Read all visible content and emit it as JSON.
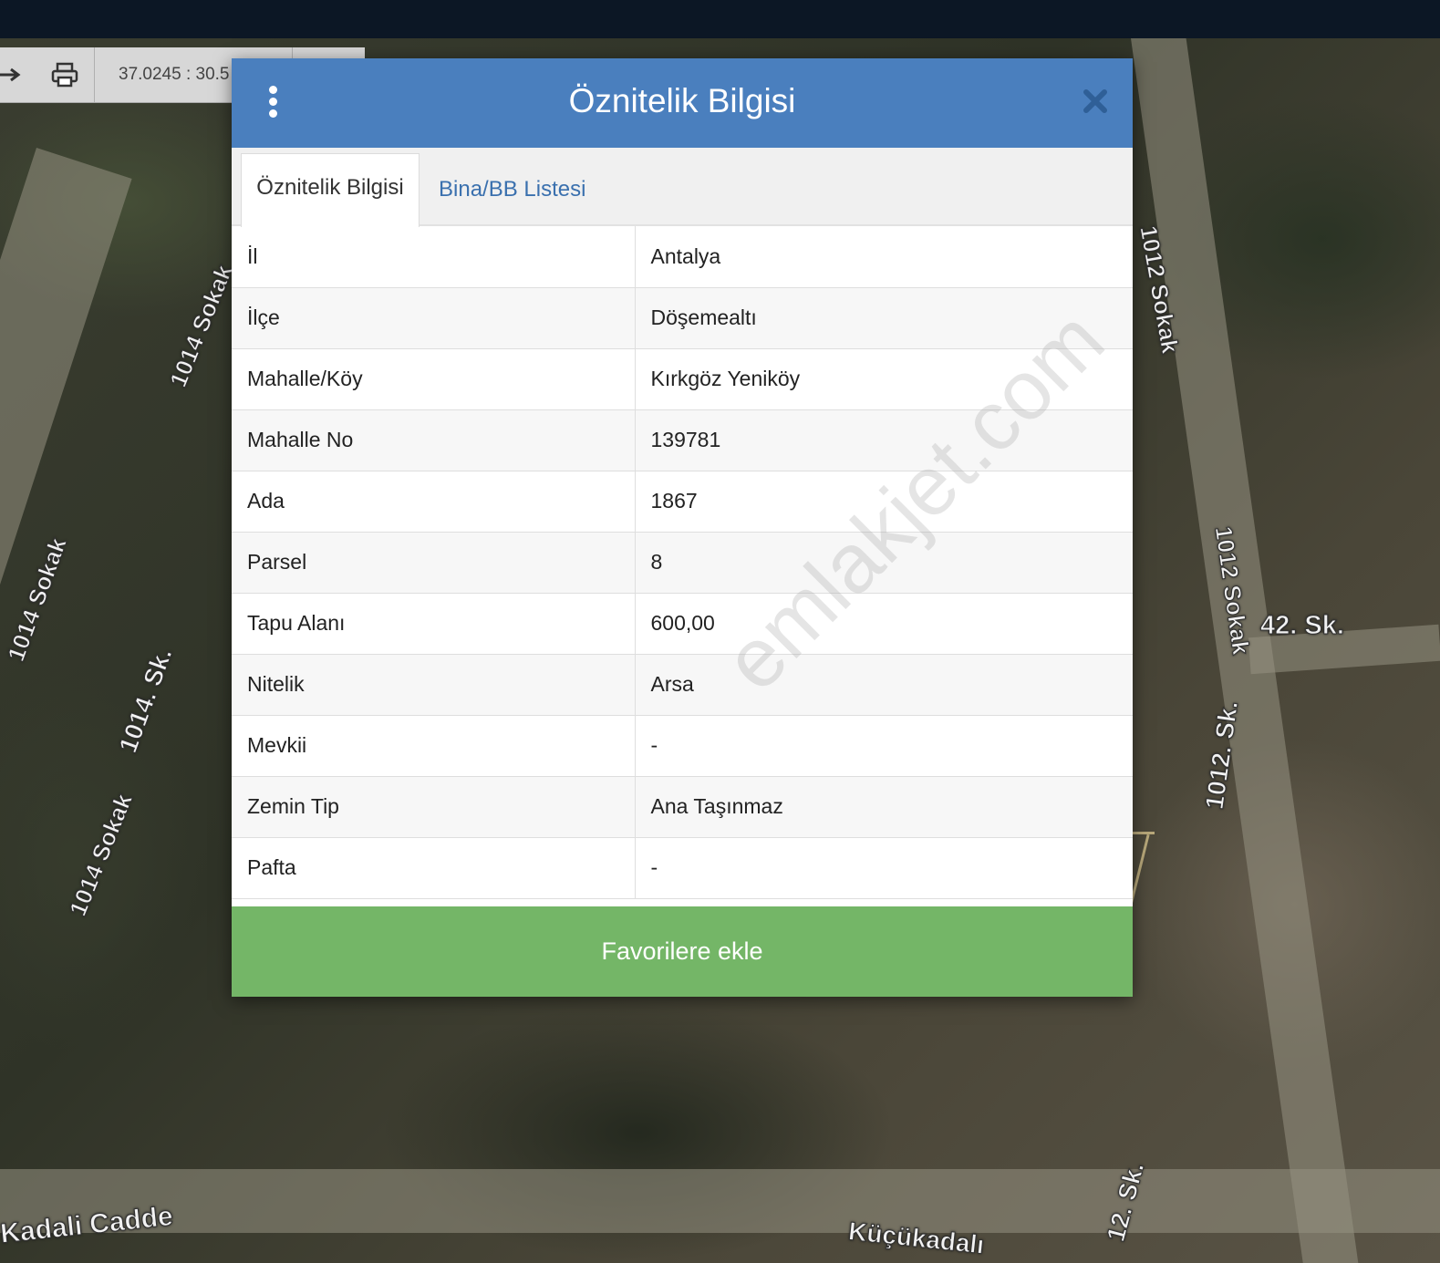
{
  "toolbar": {
    "coordinates": "37.0245 : 30.5"
  },
  "map": {
    "road_labels": [
      "1014 Sokak",
      "1014 Sokak",
      "1014. Sk.",
      "1014 Sokak",
      "1012 Sokak",
      "1012 Sokak",
      "42. Sk.",
      "1012. Sk.",
      "12. Sk.",
      "Kadali Cadde",
      "Küçükadalı"
    ]
  },
  "modal": {
    "title": "Öznitelik Bilgisi",
    "tabs": [
      {
        "label": "Öznitelik Bilgisi",
        "active": true
      },
      {
        "label": "Bina/BB Listesi",
        "active": false
      }
    ],
    "rows": [
      {
        "key": "İl",
        "value": "Antalya"
      },
      {
        "key": "İlçe",
        "value": "Döşemealtı"
      },
      {
        "key": "Mahalle/Köy",
        "value": "Kırkgöz Yeniköy"
      },
      {
        "key": "Mahalle No",
        "value": "139781"
      },
      {
        "key": "Ada",
        "value": "1867"
      },
      {
        "key": "Parsel",
        "value": "8"
      },
      {
        "key": "Tapu Alanı",
        "value": "600,00"
      },
      {
        "key": "Nitelik",
        "value": "Arsa"
      },
      {
        "key": "Mevkii",
        "value": "-"
      },
      {
        "key": "Zemin Tip",
        "value": "Ana Taşınmaz"
      },
      {
        "key": "Pafta",
        "value": "-"
      }
    ],
    "favorite_label": "Favorilere ekle",
    "watermark": "emlakjet.com"
  },
  "colors": {
    "header": "#4a7fbe",
    "favorite": "#74b667",
    "tab_link": "#3a70ae"
  }
}
